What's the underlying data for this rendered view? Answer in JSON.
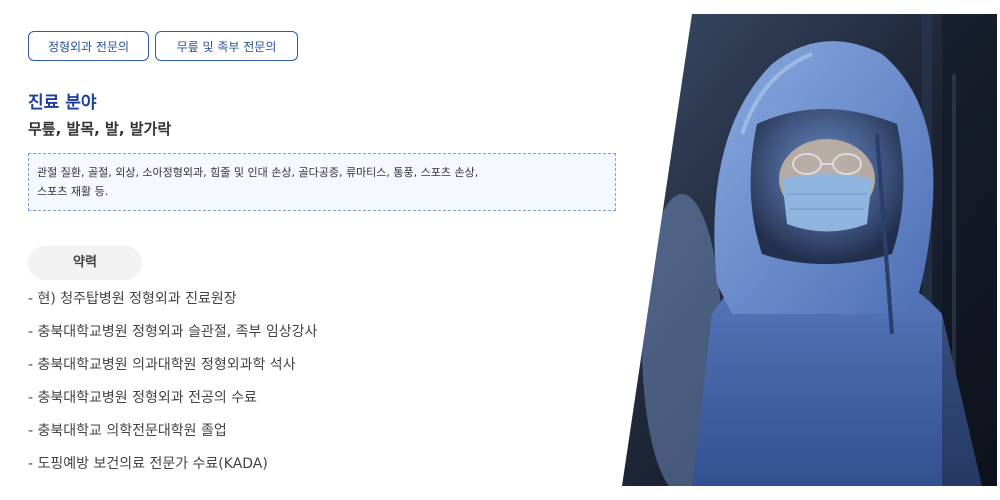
{
  "tags": [
    {
      "label": "정형외과 전문의"
    },
    {
      "label": "무릎 및 족부 전문의"
    }
  ],
  "specialty": {
    "title": "진료 분야",
    "subtitle": "무릎, 발목, 발, 발가락",
    "detail_line1": "관절 질환, 골절, 외상, 소아정형외과, 힘줄 및 인대 손상, 골다공증, 류마티스, 통풍, 스포츠 손상,",
    "detail_line2": "스포츠 재활 등."
  },
  "career": {
    "title": "약력",
    "items": [
      "- 현) 청주탑병원 정형외과 진료원장",
      "- 충북대학교병원 정형외과 슬관절, 족부 임상강사",
      "- 충북대학교병원 의과대학원 정형외과학 석사",
      "- 충북대학교병원 정형외과 전공의 수료",
      "- 충북대학교 의학전문대학원 졸업",
      "- 도핑예방 보건의료 전문가 수료(KADA)"
    ]
  },
  "photo": {
    "icon": "surgeon-photo",
    "colors": {
      "gown": "#4f6fb0",
      "hood": "#6b8fd0",
      "dark": "#1b2333",
      "mask": "#8fb4dd"
    }
  }
}
